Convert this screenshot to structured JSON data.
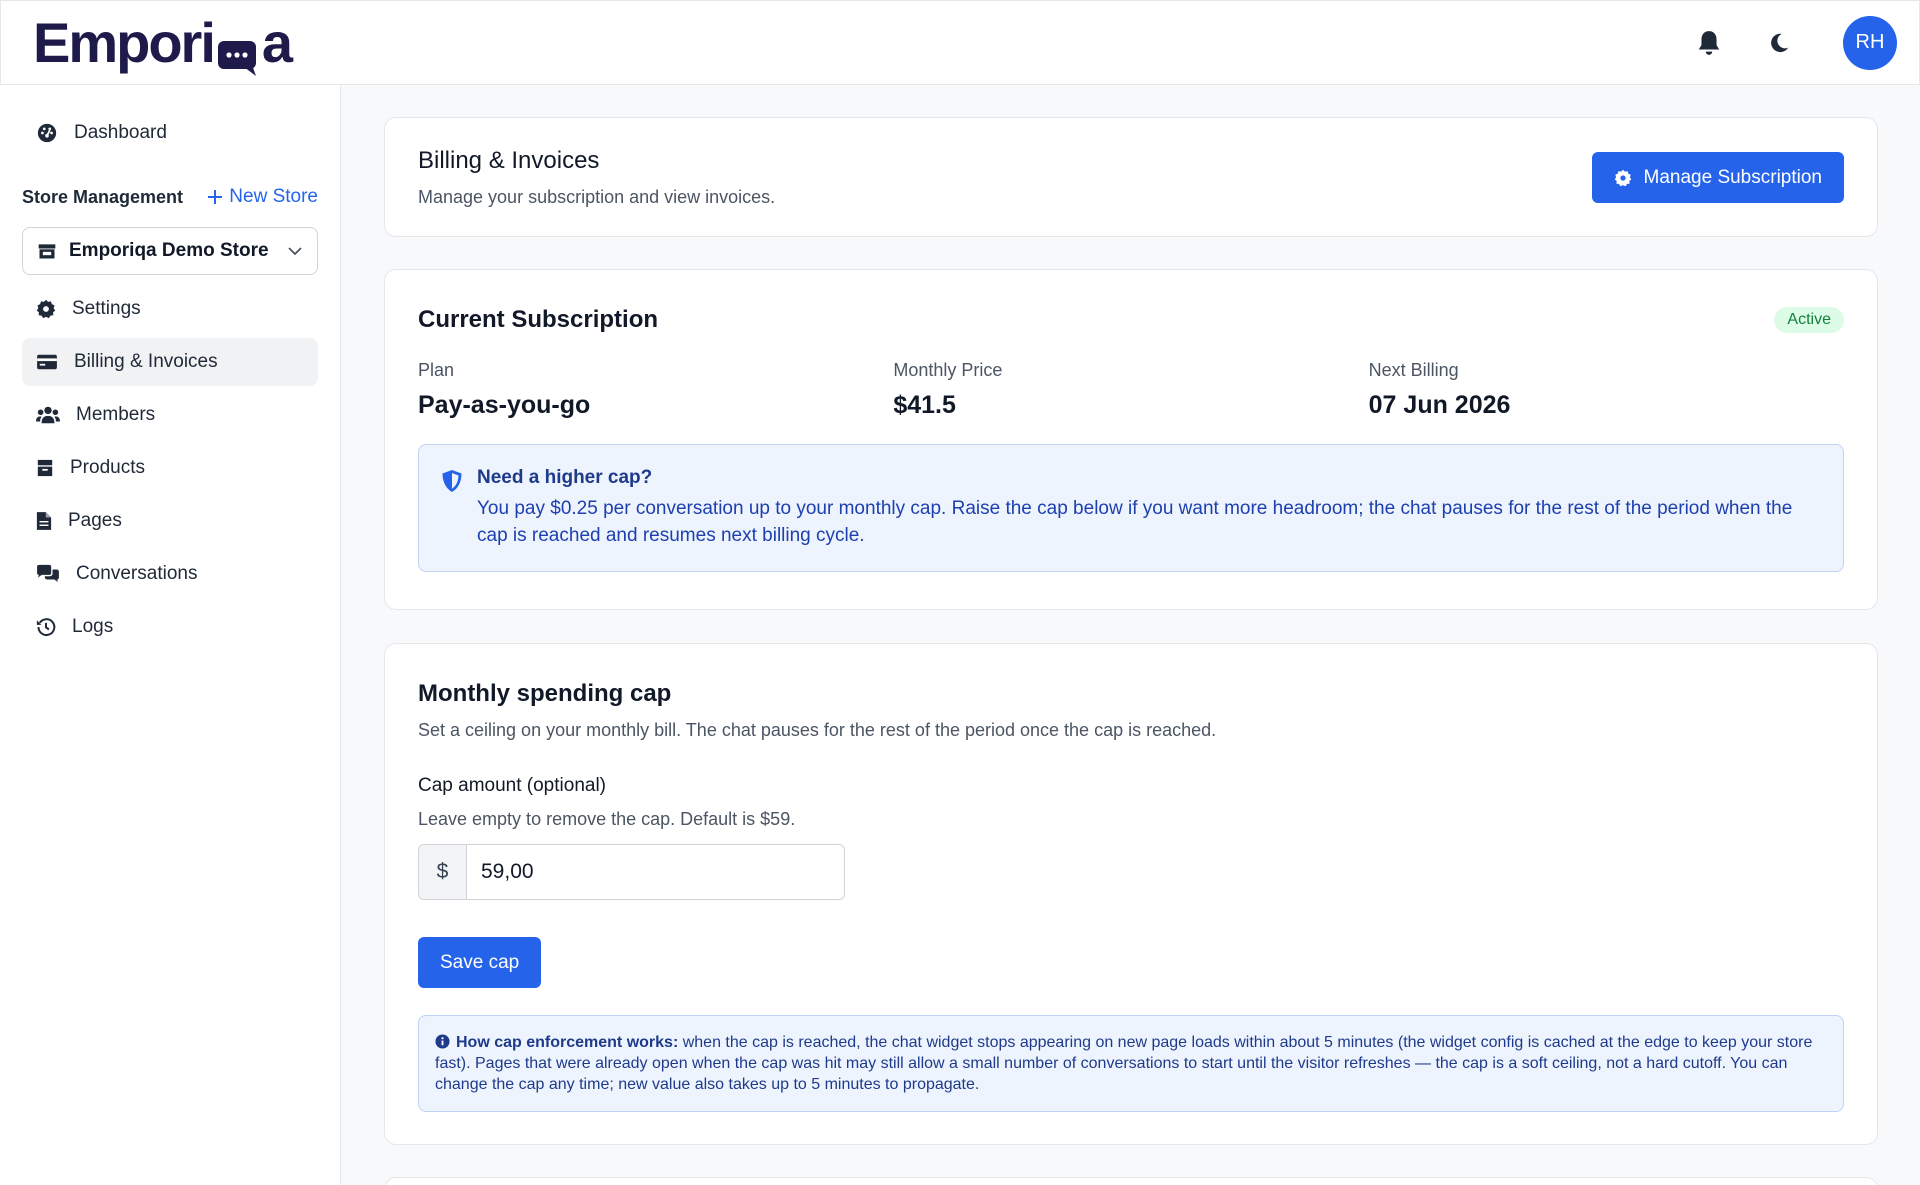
{
  "header": {
    "logo_text_left": "Empori",
    "logo_text_right": "a",
    "notifications_icon": "bell-icon",
    "theme_icon": "moon-icon",
    "avatar_initials": "RH"
  },
  "sidebar": {
    "dashboard_label": "Dashboard",
    "section_title": "Store Management",
    "new_store_label": "New Store",
    "store_selected": "Emporiqa Demo Store",
    "items": [
      {
        "label": "Settings",
        "icon": "gear-icon"
      },
      {
        "label": "Billing & Invoices",
        "icon": "credit-card-icon",
        "active": true
      },
      {
        "label": "Members",
        "icon": "users-icon"
      },
      {
        "label": "Products",
        "icon": "box-icon"
      },
      {
        "label": "Pages",
        "icon": "file-icon"
      },
      {
        "label": "Conversations",
        "icon": "comments-icon"
      },
      {
        "label": "Logs",
        "icon": "history-icon"
      }
    ]
  },
  "billing_header": {
    "title": "Billing & Invoices",
    "subtitle": "Manage your subscription and view invoices.",
    "manage_button": "Manage Subscription"
  },
  "subscription": {
    "title": "Current Subscription",
    "status": "Active",
    "plan_label": "Plan",
    "plan_value": "Pay-as-you-go",
    "price_label": "Monthly Price",
    "price_value": "$41.5",
    "next_billing_label": "Next Billing",
    "next_billing_value": "07 Jun 2026",
    "notice_title": "Need a higher cap?",
    "notice_text": "You pay $0.25 per conversation up to your monthly cap. Raise the cap below if you want more headroom; the chat pauses for the rest of the period when the cap is reached and resumes next billing cycle."
  },
  "spending_cap": {
    "title": "Monthly spending cap",
    "subtitle": "Set a ceiling on your monthly bill. The chat pauses for the rest of the period once the cap is reached.",
    "field_label": "Cap amount (optional)",
    "field_help": "Leave empty to remove the cap. Default is $59.",
    "currency_prefix": "$",
    "value": "59,00",
    "save_button": "Save cap",
    "info_bold": "How cap enforcement works:",
    "info_text": " when the cap is reached, the chat widget stops appearing on new page loads within about 5 minutes (the widget config is cached at the edge to keep your store fast). Pages that were already open when the cap was hit may still allow a small number of conversations to start until the visitor refreshes — the cap is a soft ceiling, not a hard cutoff. You can change the cap any time; new value also takes up to 5 minutes to propagate."
  },
  "colors": {
    "primary": "#2563eb",
    "logo": "#1e1b4b",
    "active_badge_bg": "#dcfce7",
    "active_badge_text": "#15803d",
    "notice_bg": "#eef4fe"
  }
}
